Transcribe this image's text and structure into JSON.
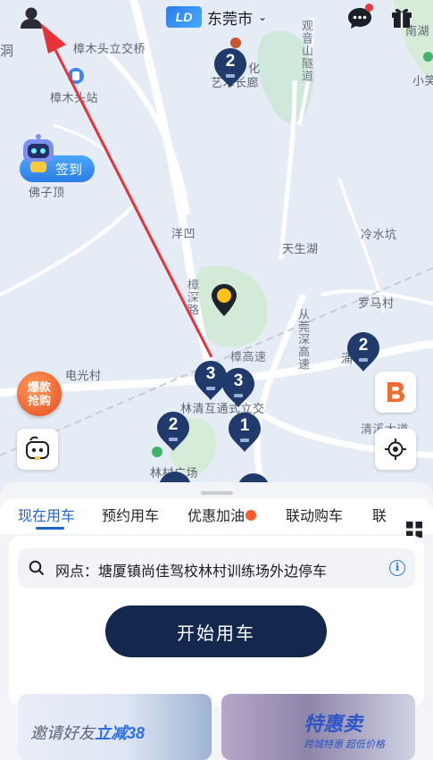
{
  "header": {
    "city": "东莞市"
  },
  "map": {
    "labels": {
      "tl_edge": "洞",
      "interchange": "樟木头立交桥",
      "station": "樟木头站",
      "hill": "佛子顶",
      "village_yangao": "洋凹",
      "zhangshen_road": "樟深路",
      "tianshenghu": "天生湖",
      "lingshuikeng": "冷水坑",
      "luomacun": "罗马村",
      "diangoang": "电光村",
      "highway_branch": "樟高速",
      "congguan_highway": "从莞深高速",
      "linqing_interchange": "林清互通式立交",
      "qingxi_road": "清溪大道",
      "forest_square": "林村广场",
      "tunnel": "观音山隧道",
      "nanhu": "南湖",
      "xiaoxiao": "小笑",
      "art_gallery_line1": "化",
      "art_gallery_line2": "艺术长廊",
      "kaomu": "涌"
    },
    "markers": [
      "2",
      "3",
      "3",
      "2",
      "1",
      "2"
    ],
    "checkin_label": "签到",
    "hot_buy_label_line1": "爆款",
    "hot_buy_label_line2": "抢购"
  },
  "tabs": [
    {
      "label": "现在用车"
    },
    {
      "label": "预约用车"
    },
    {
      "label": "优惠加油"
    },
    {
      "label": "联动购车"
    },
    {
      "label": "联"
    }
  ],
  "search": {
    "value": "网点：塘厦镇尚佳驾校林村训练场外边停车"
  },
  "start_button": "开始用车",
  "promos": {
    "invite_prefix": "邀请好友",
    "invite_highlight": "立减38",
    "special_big": "特惠卖",
    "special_small": "跨城特惠 超低价格"
  },
  "colors": {
    "accent": "#1d63c9",
    "marker": "#1f3a6b",
    "start_button": "#14284e",
    "arrow": "#e8323a"
  }
}
